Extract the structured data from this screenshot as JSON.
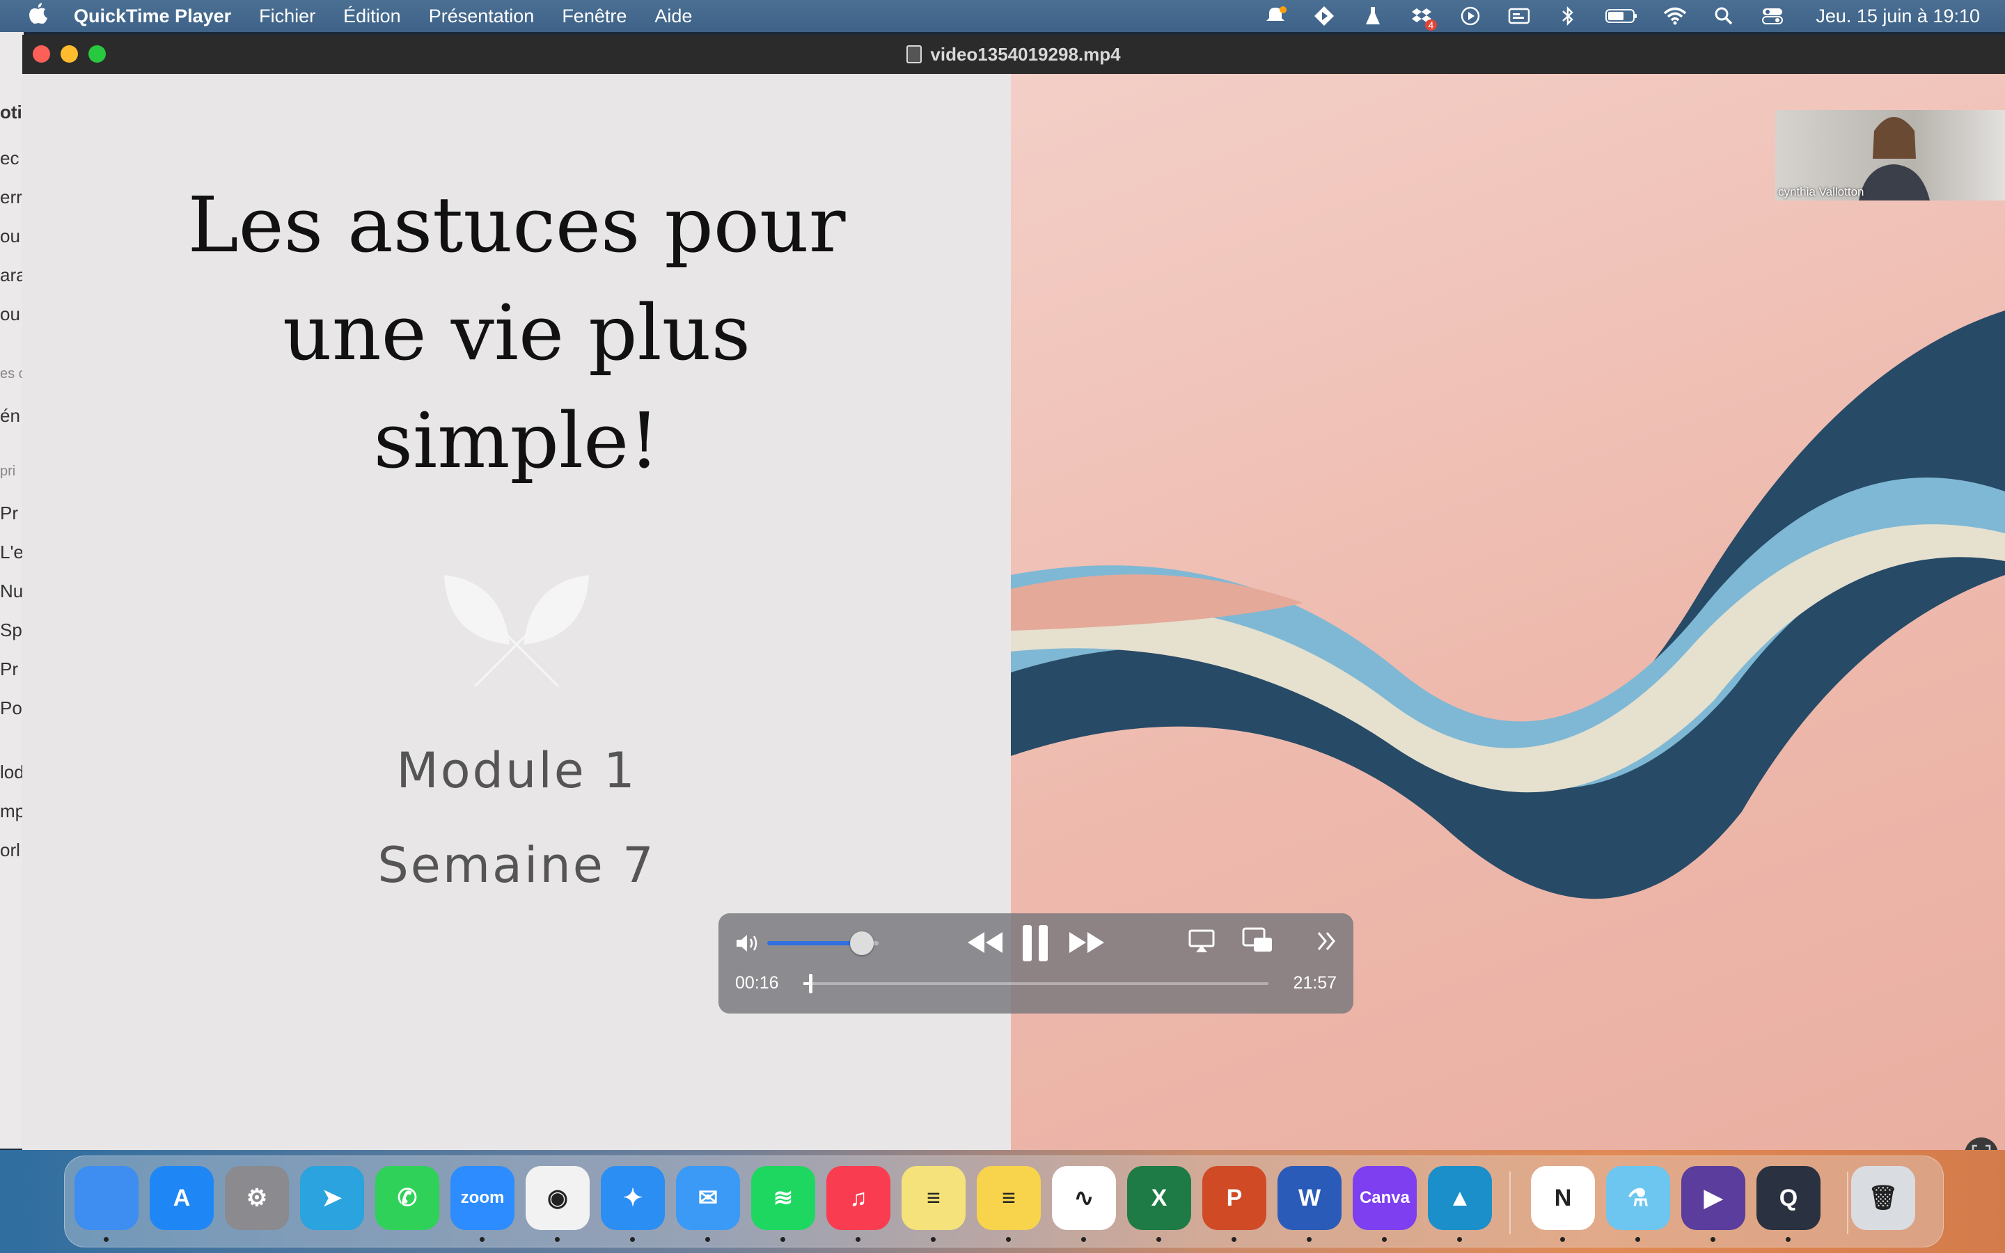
{
  "menubar": {
    "app_name": "QuickTime Player",
    "items": [
      "Fichier",
      "Édition",
      "Présentation",
      "Fenêtre",
      "Aide"
    ],
    "notification_badge": "4",
    "clock": "Jeu. 15 juin à 19:10"
  },
  "background_app_fragments": [
    "oti",
    "ec",
    "err",
    "ou",
    "ara",
    "ou",
    "es c",
    "én",
    "pri",
    "Pr",
    "L'e",
    "Nu",
    "Sp",
    "Pr",
    "Po",
    "lod",
    "mp",
    "orl"
  ],
  "window": {
    "title": "video1354019298.mp4"
  },
  "slide": {
    "headline": [
      "Les astuces pour",
      "une vie plus",
      "simple!"
    ],
    "module": "Module 1",
    "week": "Semaine 7"
  },
  "webcam": {
    "name": "cynthia Vallotton"
  },
  "player": {
    "elapsed": "00:16",
    "total": "21:57",
    "volume": 0.85,
    "progress": 0.012
  },
  "dock": {
    "apps": [
      {
        "name": "Finder",
        "color": "#3d8ef0",
        "label": ""
      },
      {
        "name": "App Store",
        "color": "#1f87f5",
        "label": "A"
      },
      {
        "name": "Réglages Système",
        "color": "#8a8a8f",
        "label": "⚙"
      },
      {
        "name": "Telegram",
        "color": "#2aa3df",
        "label": "➤"
      },
      {
        "name": "WhatsApp",
        "color": "#2fd158",
        "label": "✆"
      },
      {
        "name": "Zoom",
        "color": "#2d8cff",
        "label": "zoom"
      },
      {
        "name": "Chrome",
        "color": "#f2f2f2",
        "label": "◉"
      },
      {
        "name": "Safari",
        "color": "#2b8ef2",
        "label": "✦"
      },
      {
        "name": "Mail",
        "color": "#3b9af5",
        "label": "✉"
      },
      {
        "name": "Spotify",
        "color": "#1ed760",
        "label": "≋"
      },
      {
        "name": "Musique",
        "color": "#fa3c50",
        "label": "♫"
      },
      {
        "name": "Stickies",
        "color": "#f5e27a",
        "label": "≡"
      },
      {
        "name": "Notes",
        "color": "#f7d44c",
        "label": "≡"
      },
      {
        "name": "Freeform",
        "color": "#ffffff",
        "label": "∿"
      },
      {
        "name": "Excel",
        "color": "#1f7b45",
        "label": "X"
      },
      {
        "name": "PowerPoint",
        "color": "#d04a26",
        "label": "P"
      },
      {
        "name": "Word",
        "color": "#2b5bb8",
        "label": "W"
      },
      {
        "name": "Canva",
        "color": "#7d3ff0",
        "label": "Canva"
      },
      {
        "name": "Affinity",
        "color": "#1a8fc9",
        "label": "▲"
      },
      {
        "name": "Notion",
        "color": "#ffffff",
        "label": "N"
      },
      {
        "name": "Lab",
        "color": "#6cc6f0",
        "label": "⚗"
      },
      {
        "name": "Infuse",
        "color": "#5a3d9c",
        "label": "▶"
      },
      {
        "name": "QuickTime Player",
        "color": "#2a3140",
        "label": "Q"
      },
      {
        "name": "Corbeille",
        "color": "#d9dde2",
        "label": "🗑"
      }
    ]
  }
}
